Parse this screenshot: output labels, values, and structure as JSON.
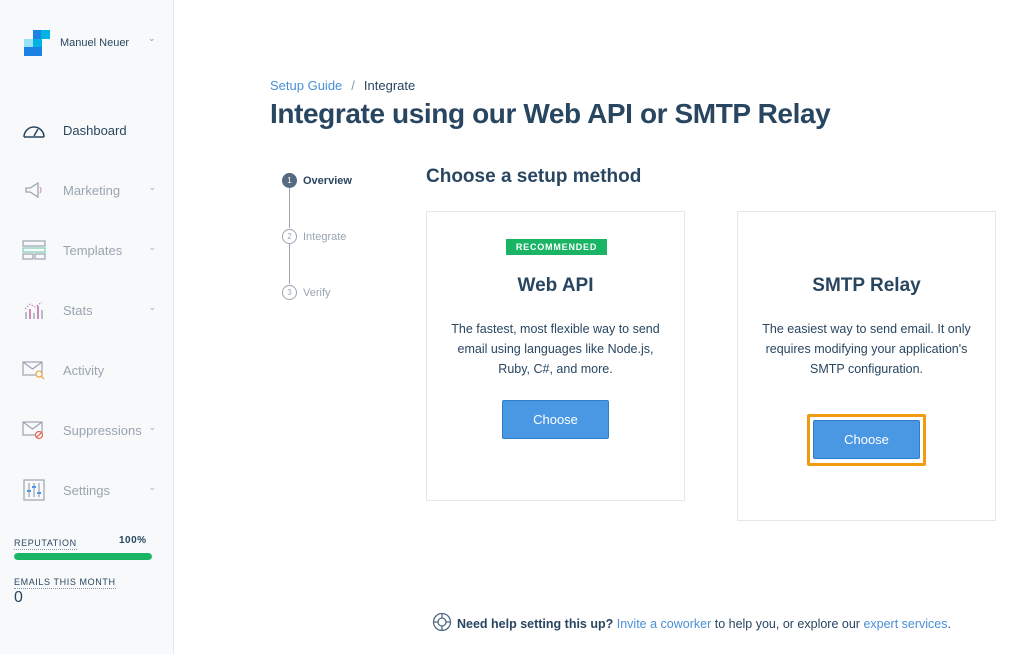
{
  "sidebar": {
    "account_name": "Manuel Neuer",
    "items": [
      {
        "label": "Dashboard",
        "icon": "gauge-icon",
        "active": true
      },
      {
        "label": "Marketing",
        "icon": "megaphone-icon",
        "has_submenu": true
      },
      {
        "label": "Templates",
        "icon": "templates-icon",
        "has_submenu": true
      },
      {
        "label": "Stats",
        "icon": "stats-chart-icon",
        "has_submenu": true
      },
      {
        "label": "Activity",
        "icon": "envelope-search-icon"
      },
      {
        "label": "Suppressions",
        "icon": "envelope-blocked-icon",
        "has_submenu": true
      },
      {
        "label": "Settings",
        "icon": "sliders-icon",
        "has_submenu": true
      }
    ],
    "reputation": {
      "label": "REPUTATION",
      "value": "100%",
      "percent": 100
    },
    "emails_this_month": {
      "label": "EMAILS THIS MONTH",
      "value": "0"
    }
  },
  "breadcrumb": {
    "link": "Setup Guide",
    "separator": "/",
    "current": "Integrate"
  },
  "page_title": "Integrate using our Web API or SMTP Relay",
  "steps": [
    {
      "number": "1",
      "label": "Overview",
      "active": true
    },
    {
      "number": "2",
      "label": "Integrate",
      "active": false
    },
    {
      "number": "3",
      "label": "Verify",
      "active": false
    }
  ],
  "section_title": "Choose a setup method",
  "cards": [
    {
      "badge": "RECOMMENDED",
      "title": "Web API",
      "description": "The fastest, most flexible way to send email using languages like Node.js, Ruby, C#, and more.",
      "button": "Choose"
    },
    {
      "title": "SMTP Relay",
      "description": "The easiest way to send email. It only requires modifying your application's SMTP configuration.",
      "button": "Choose"
    }
  ],
  "help": {
    "icon": "lifebuoy-icon",
    "bold": "Need help setting this up?",
    "link1": "Invite a coworker",
    "middle": "to help you, or explore our",
    "link2": "expert services",
    "end": "."
  },
  "colors": {
    "primary_text": "#294661",
    "link": "#4a8fd6",
    "button": "#4a98e4",
    "success": "#1ab465",
    "focus": "#f29a12"
  }
}
